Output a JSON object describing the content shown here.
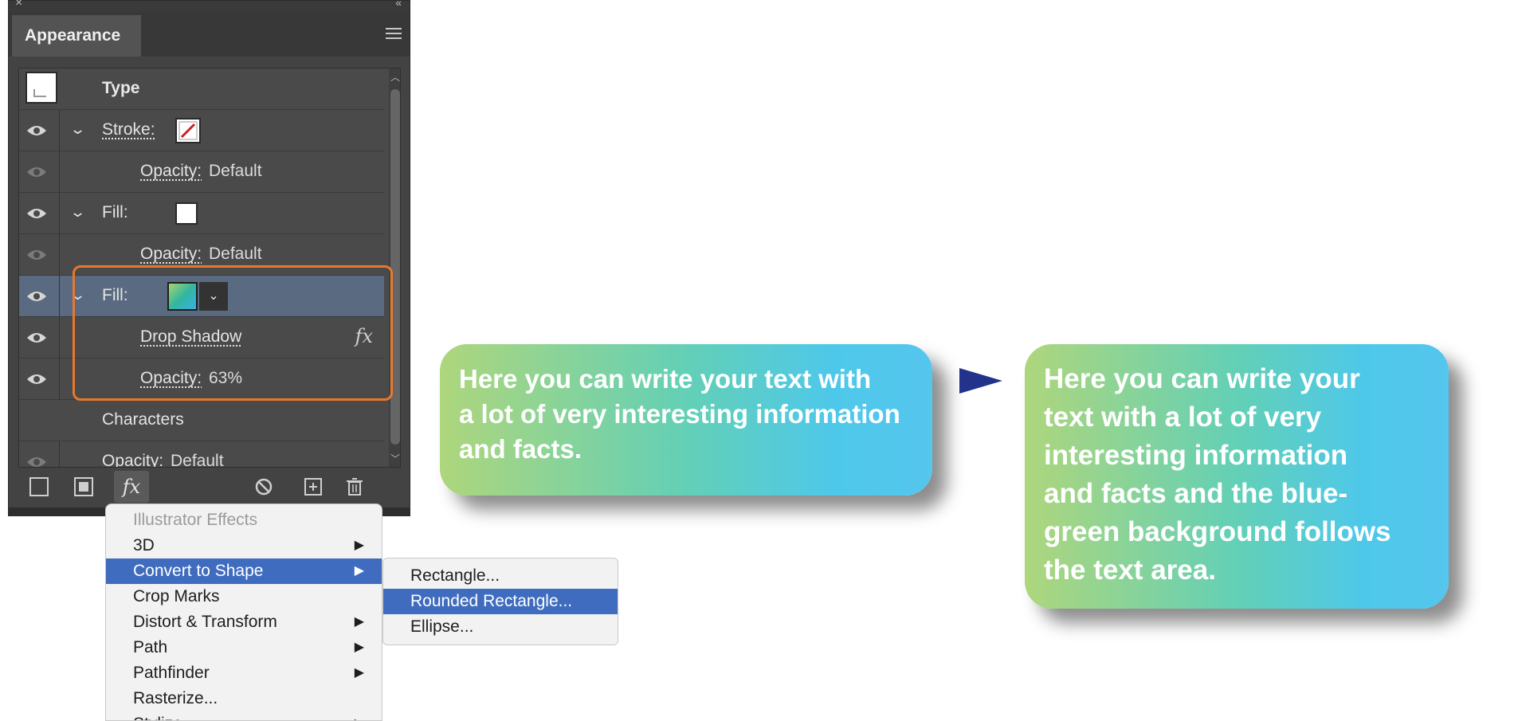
{
  "panel": {
    "tab_title": "Appearance",
    "rows": {
      "type_label": "Type",
      "stroke_label": "Stroke:",
      "stroke_opacity_label": "Opacity:",
      "stroke_opacity_value": "Default",
      "fill1_label": "Fill:",
      "fill1_opacity_label": "Opacity:",
      "fill1_opacity_value": "Default",
      "fill2_label": "Fill:",
      "drop_shadow_label": "Drop Shadow",
      "fill2_opacity_label": "Opacity:",
      "fill2_opacity_value": "63%",
      "characters_label": "Characters",
      "char_opacity_label": "Opacity:",
      "char_opacity_value": "Default"
    },
    "toolbar": {
      "fx_label": "fx"
    }
  },
  "effects_menu": {
    "header": "Illustrator Effects",
    "items": [
      "3D",
      "Convert to Shape",
      "Crop Marks",
      "Distort & Transform",
      "Path",
      "Pathfinder",
      "Rasterize...",
      "Stylize"
    ],
    "submenu": [
      "Rectangle...",
      "Rounded Rectangle...",
      "Ellipse..."
    ]
  },
  "callouts": {
    "before": [
      "Here you can write your text with",
      "a lot of very interesting information",
      "and facts."
    ],
    "after": [
      "Here you can write your",
      "text with a lot of very",
      "interesting information",
      "and facts  and the blue-",
      "green background follows",
      "the text area."
    ]
  },
  "colors": {
    "panel_bg": "#434343",
    "selection_row": "#5a6a80",
    "highlight_box": "#e8782c",
    "menu_highlight": "#3f6cbf",
    "gradient_start": "#aed67c",
    "gradient_end": "#4ec8ea",
    "arrow": "#23328a"
  }
}
